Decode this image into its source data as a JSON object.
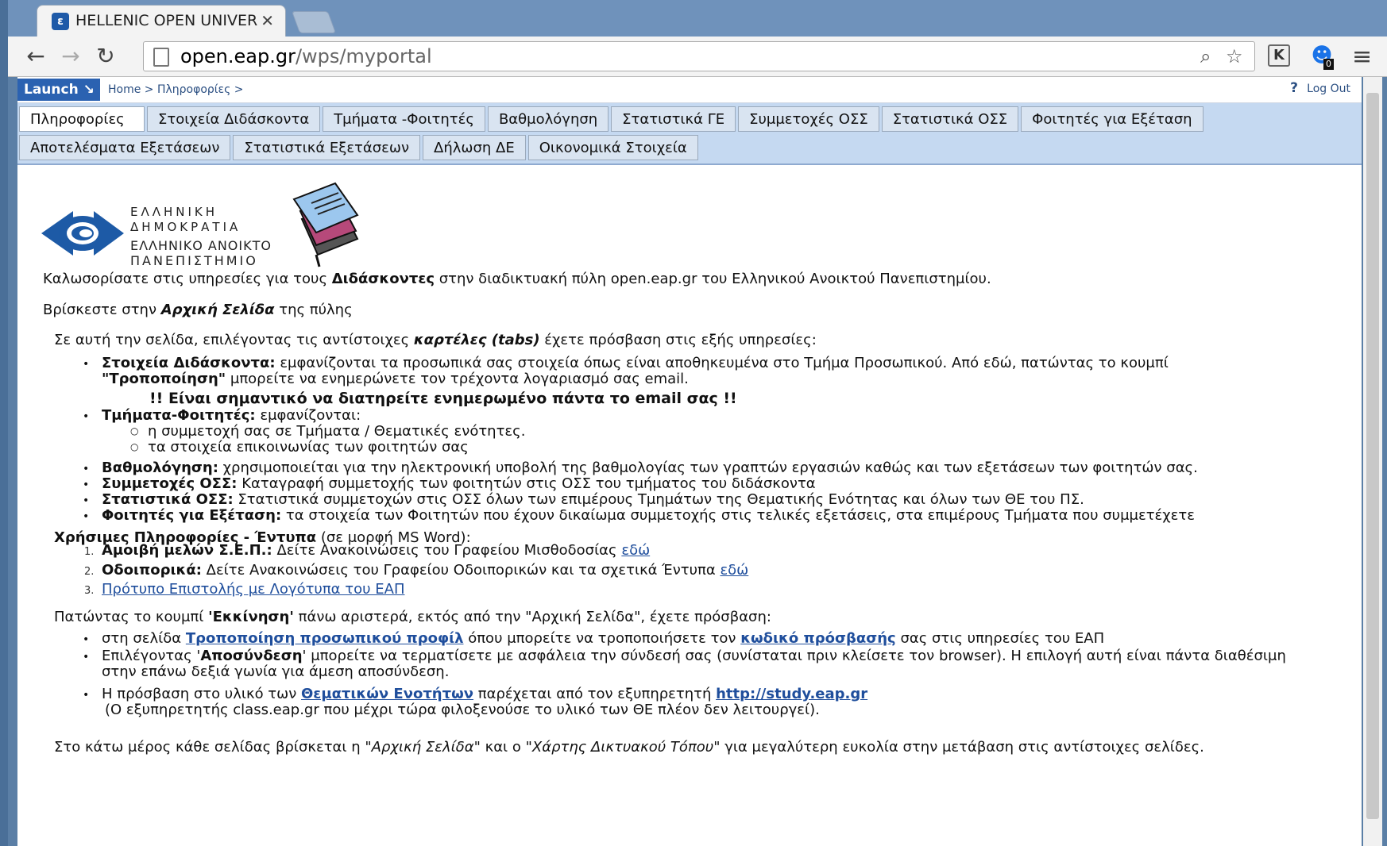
{
  "browser": {
    "tab_title": "HELLENIC OPEN UNIVERS",
    "url_host": "open.eap.gr",
    "url_path": "/wps/myportal"
  },
  "portal": {
    "launch_label": "Launch ↘",
    "breadcrumb": "Home > Πληροφορίες >",
    "help": "?",
    "logout": "Log Out"
  },
  "nav_row1": [
    "Πληροφορίες",
    "Στοιχεία Διδάσκοντα",
    "Τμήματα -Φοιτητές",
    "Βαθμολόγηση",
    "Στατιστικά ΓΕ",
    "Συμμετοχές ΟΣΣ",
    "Στατιστικά ΟΣΣ",
    "Φοιτητές για Εξέταση"
  ],
  "nav_row2": [
    "Αποτελέσματα Εξετάσεων",
    "Στατιστικά Εξετάσεων",
    "Δήλωση ΔΕ",
    "Οικονομικά Στοιχεία"
  ],
  "logo": {
    "l1": "ΕΛΛΗΝΙΚΗ",
    "l2": "ΔΗΜΟΚΡΑΤΙΑ",
    "l3": "ΕΛΛΗΝΙΚΟ ΑΝΟΙΚΤΟ",
    "l4": "ΠΑΝΕΠΙΣΤΗΜΙΟ"
  },
  "content": {
    "welcome_a": "Καλωσορίσατε στις υπηρεσίες για τους ",
    "welcome_b": "Διδάσκοντες",
    "welcome_c": " στην διαδικτυακή πύλη open.eap.gr του Ελληνικού Ανοικτού Πανεπιστημίου.",
    "home_a": "Βρίσκεστε στην ",
    "home_b": "Αρχική Σελίδα",
    "home_c": " της πύλης",
    "intro_a": "Σε αυτή  την σελίδα, επιλέγοντας τις αντίστοιχες ",
    "intro_b": "καρτέλες (tabs)",
    "intro_c": " έχετε πρόσβαση στις εξής υπηρεσίες:",
    "s1_b": "Στοιχεία Διδάσκοντα:",
    "s1_t": "       εμφανίζονται τα προσωπικά σας στοιχεία όπως είναι αποθηκευμένα στο Τμήμα Προσωπικού. Από εδώ, πατώντας το κουμπί",
    "s1_b2": "\"Τροποποίηση\"",
    "s1_t2": " μπορείτε να ενημερώνετε τον τρέχοντα λογαριασμό σας email.",
    "s1_warn": "!! Είναι σημαντικό να διατηρείτε ενημερωμένο πάντα το email σας !!",
    "s2_b": "Τμήματα-Φοιτητές:",
    "s2_t": "  εμφανίζονται:",
    "s2_i1": "η συμμετοχή σας σε Τμήματα / Θεματικές ενότητες.",
    "s2_i2": "τα στοιχεία επικοινωνίας των φοιτητών σας",
    "s3_b": "Βαθμολόγηση:",
    "s3_t": "   χρησιμοποιείται για την ηλεκτρονική υποβολή της βαθμολογίας των γραπτών εργασιών καθώς και των εξετάσεων των φοιτητών σας.",
    "s4_b": "Συμμετοχές ΟΣΣ:",
    "s4_t": " Καταγραφή συμμετοχής των φοιτητών στις ΟΣΣ του τμήματος του διδάσκοντα",
    "s5_b": "Στατιστικά ΟΣΣ:",
    "s5_t": " Στατιστικά συμμετοχών στις ΟΣΣ όλων των επιμέρους Τμημάτων της Θεματικής Ενότητας και όλων των ΘΕ του ΠΣ.",
    "s6_b": "Φοιτητές για Εξέταση:",
    "s6_t": " τα στοιχεία των Φοιτητών που έχουν δικαίωμα συμμετοχής στις τελικές εξετάσεις, στα επιμέρους Τμήματα που συμμετέχετε",
    "useful_b": "Χρήσιμες Πληροφορίες - Έντυπα",
    "useful_t": " (σε μορφή MS Word):",
    "n1": "1.",
    "u1_b": "Αμοιβή μελών Σ.Ε.Π.:",
    "u1_t": " Δείτε Ανακοινώσεις του Γραφείου Μισθοδοσίας ",
    "u1_link": "εδώ",
    "n2": "2.",
    "u2_b": "Οδοιπορικά:",
    "u2_t": " Δείτε Ανακοινώσεις του Γραφείου Οδοιπορικών και τα σχετικά Έντυπα ",
    "u2_link": "εδώ",
    "n3": "3.",
    "u3_link": "Πρότυπο Επιστολής με Λογότυπα του ΕΑΠ",
    "start_a": "Πατώντας το κουμπί ",
    "start_b": "'Εκκίνηση'",
    "start_c": " πάνω αριστερά, εκτός από την \"Αρχική Σελίδα\", έχετε πρόσβαση:",
    "p1_a": "στη σελίδα ",
    "p1_link": "Τροποποίηση προσωπικού προφίλ",
    "p1_b": " όπου μπορείτε να τροποποιήσετε τον ",
    "p1_link2": "κωδικό πρόσβασής",
    "p1_c": " σας στις υπηρεσίες του ΕΑΠ",
    "p2_a": "Επιλέγοντας '",
    "p2_b": "Αποσύνδεση",
    "p2_c": "' μπορείτε να τερματίσετε με ασφάλεια την σύνδεσή σας (συνίσταται πριν κλείσετε τον browser). Η επιλογή αυτή είναι πάντα διαθέσιμη",
    "p2_d": "στην επάνω δεξιά γωνία για άμεση αποσύνδεση.",
    "p3_a": "Η πρόσβαση στο υλικό των ",
    "p3_link": "Θεματικών Ενοτήτων",
    "p3_b": "  παρέχεται από τον εξυπηρετητή ",
    "p3_link2": "http://study.eap.gr",
    "p3_c": "(Ο εξυπηρετητής class.eap.gr που μέχρι τώρα φιλοξενούσε το υλικό των ΘΕ πλέον δεν λειτουργεί).",
    "foot_a": "Στο κάτω μέρος κάθε σελίδας βρίσκεται η \"",
    "foot_b": "Αρχική Σελίδα",
    "foot_c": "\" και ο \"",
    "foot_d": "Χάρτης Δικτυακού Τόπου",
    "foot_e": "\" για μεγαλύτερη ευκολία  στην μετάβαση στις αντίστοιχες σελίδες."
  }
}
